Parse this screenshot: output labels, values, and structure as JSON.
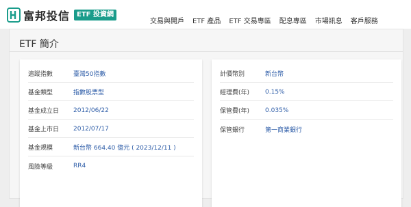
{
  "header": {
    "brand_name": "富邦投信",
    "brand_badge": "ETF 投資網",
    "nav": [
      "交易與開戶",
      "ETF 產品",
      "ETF 交易專區",
      "配息專區",
      "市場訊息",
      "客戶服務"
    ]
  },
  "page": {
    "title": "ETF 簡介"
  },
  "left_card": {
    "rows": [
      {
        "label": "追蹤指數",
        "value": "臺灣50指數"
      },
      {
        "label": "基金類型",
        "value": "指數股票型"
      },
      {
        "label": "基金成立日",
        "value": "2012/06/22"
      },
      {
        "label": "基金上市日",
        "value": "2012/07/17"
      },
      {
        "label": "基金規模",
        "value": "新台幣 664.40 億元 ( 2023/12/11 )"
      },
      {
        "label": "風險等級",
        "value": "RR4"
      }
    ]
  },
  "right_card": {
    "rows": [
      {
        "label": "計價幣別",
        "value": "新台幣"
      },
      {
        "label": "經理費(年)",
        "value": "0.15%"
      },
      {
        "label": "保管費(年)",
        "value": "0.035%"
      },
      {
        "label": "保管銀行",
        "value": "第一商業銀行"
      }
    ]
  },
  "colors": {
    "brand_badge": "#1a9c8b",
    "value_link": "#2e5da8"
  },
  "icons": {
    "logo": "fubon-logo-icon"
  }
}
